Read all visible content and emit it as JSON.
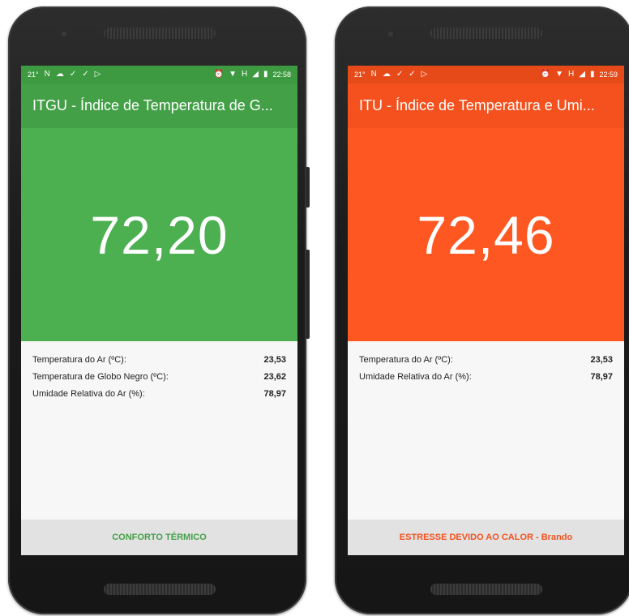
{
  "colors": {
    "green_status": "#3d9a40",
    "green_appbar": "#43a047",
    "green_hero": "#4caf50",
    "green_footer_text": "#43a047",
    "orange_status": "#e64a19",
    "orange_appbar": "#f4511e",
    "orange_hero": "#ff5722",
    "orange_footer_text": "#f4511e"
  },
  "phones": [
    {
      "status": {
        "temp": "21°",
        "time": "22:58",
        "net": "H"
      },
      "title": "ITGU - Índice de Temperatura de G...",
      "index_value": "72,20",
      "rows": [
        {
          "label": "Temperatura do Ar (ºC):",
          "value": "23,53"
        },
        {
          "label": "Temperatura de Globo Negro (ºC):",
          "value": "23,62"
        },
        {
          "label": "Umidade Relativa do Ar (%):",
          "value": "78,97"
        }
      ],
      "footer": "CONFORTO TÉRMICO"
    },
    {
      "status": {
        "temp": "21°",
        "time": "22:59",
        "net": "H"
      },
      "title": "ITU - Índice de Temperatura e Umi...",
      "index_value": "72,46",
      "rows": [
        {
          "label": "Temperatura do Ar (ºC):",
          "value": "23,53"
        },
        {
          "label": "Umidade Relativa do Ar (%):",
          "value": "78,97"
        }
      ],
      "footer": "ESTRESSE DEVIDO AO CALOR - Brando"
    }
  ]
}
